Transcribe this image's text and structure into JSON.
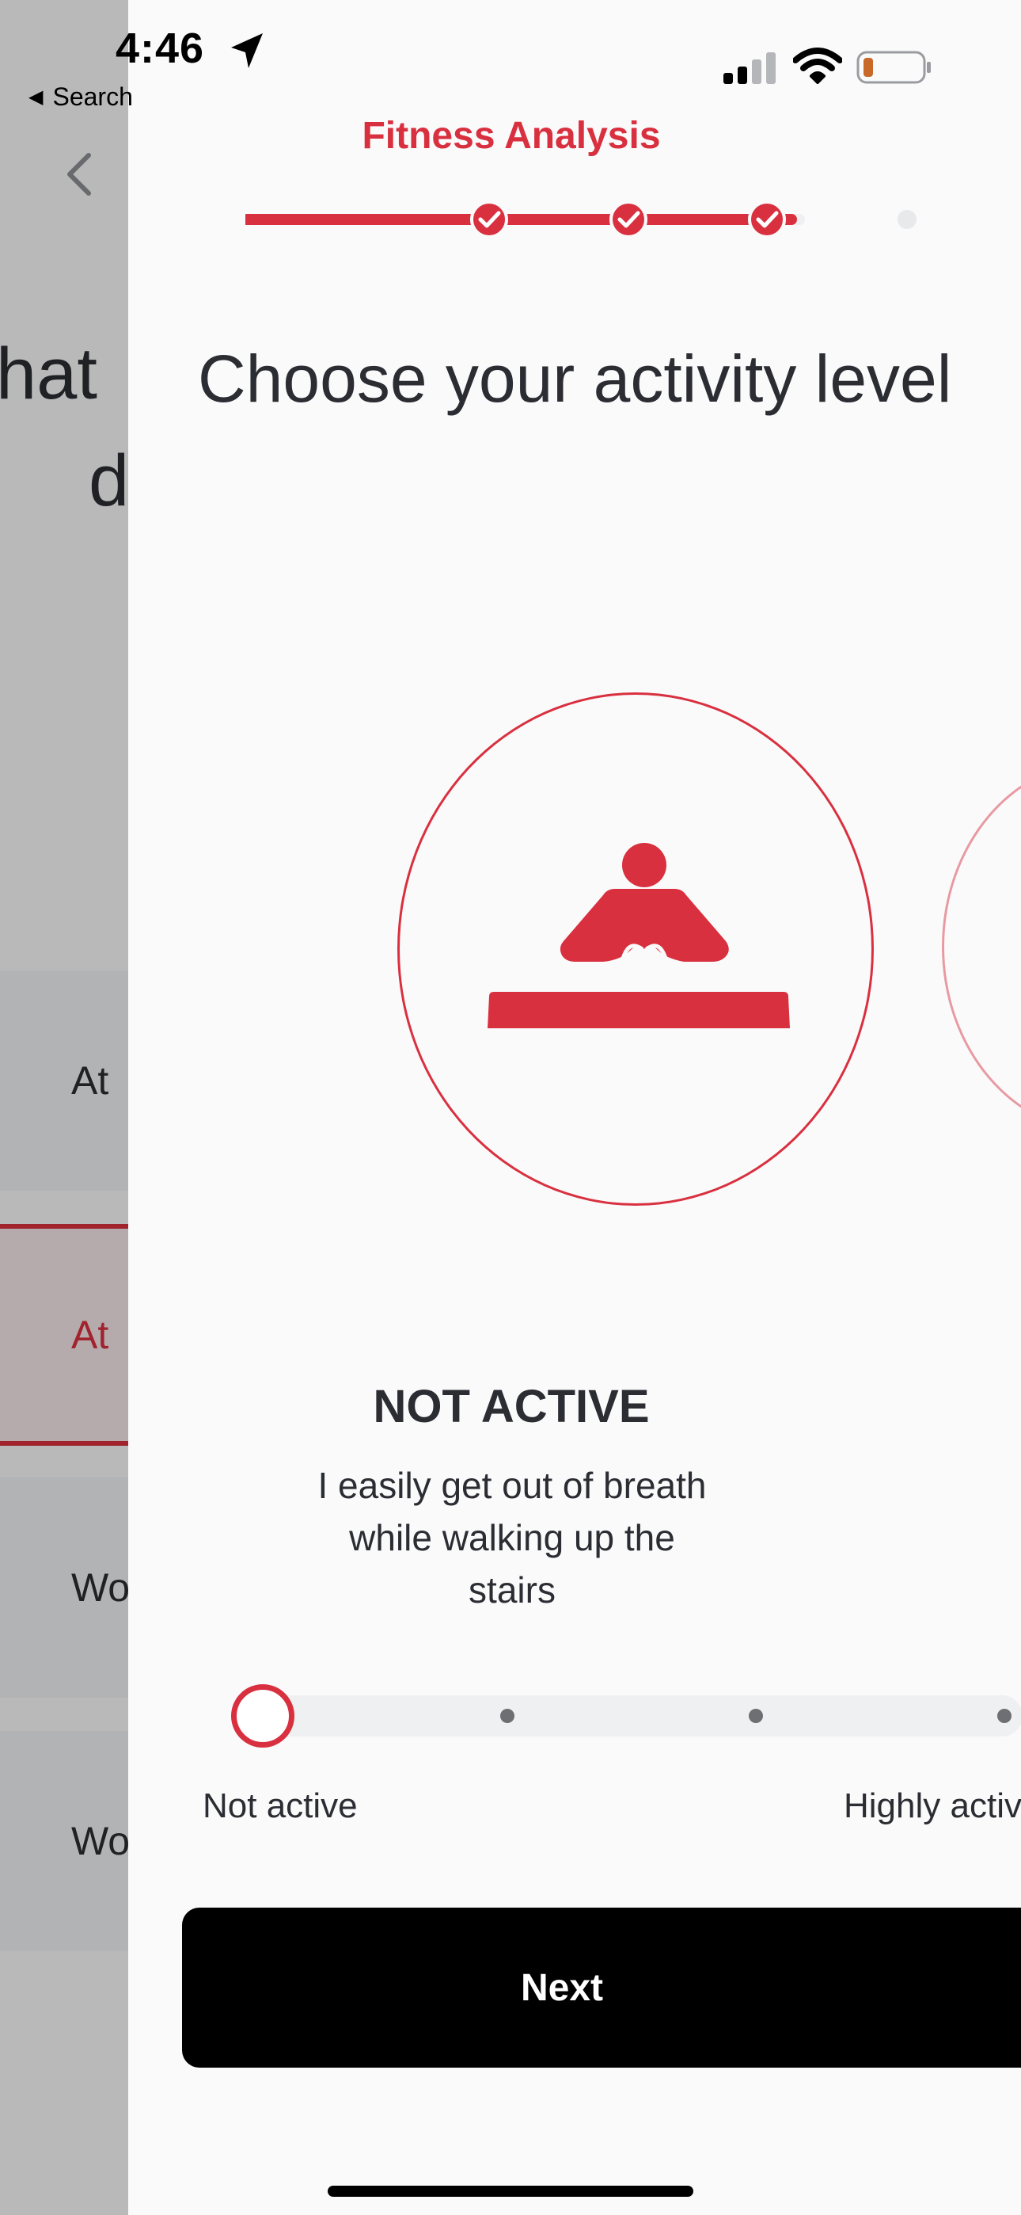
{
  "status_bar": {
    "time": "4:46",
    "back_label": "Search"
  },
  "background_screen": {
    "title_line1": "hat",
    "title_line2": "d",
    "options": [
      "At",
      "At",
      "Wo",
      "Wo"
    ]
  },
  "header": {
    "title": "Fitness Analysis",
    "progress_steps_completed": 3,
    "progress_steps_total": 4
  },
  "question": "Choose your activity level",
  "selected_level": {
    "title": "NOT ACTIVE",
    "description": "I easily get out of breath while walking up the stairs",
    "icon": "person-sitting-icon"
  },
  "slider": {
    "min_label": "Not active",
    "max_label": "Highly active",
    "value": 0,
    "steps": 5
  },
  "next_button": {
    "label": "Next"
  },
  "colors": {
    "accent": "#d9303f",
    "text": "#2b2d33",
    "button": "#000000",
    "background": "#fafafb"
  }
}
